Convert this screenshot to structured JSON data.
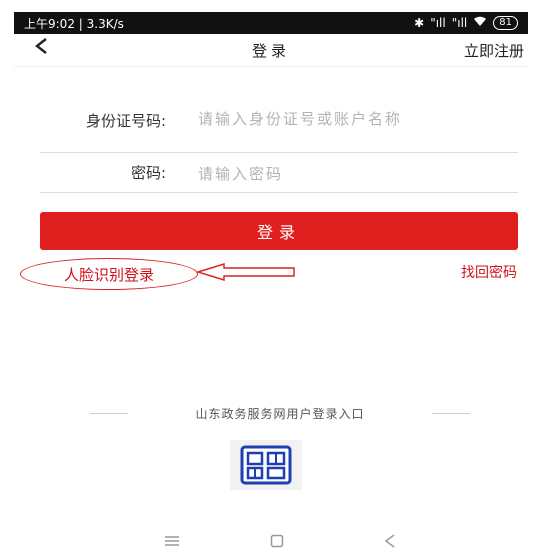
{
  "status_bar": {
    "time_speed": "上午9:02 | 3.3K/s",
    "signal1": "\"ıll",
    "signal2": "\"ıll",
    "battery": "81"
  },
  "nav": {
    "title": "登录",
    "register": "立即注册"
  },
  "form": {
    "id_label": "身份证号码:",
    "id_placeholder": "请输入身份证号或账户名称",
    "password_label": "密码:",
    "password_placeholder": "请输入密码",
    "login_button": "登录"
  },
  "links": {
    "face_login": "人脸识别登录",
    "find_password": "找回密码"
  },
  "footer": {
    "portal_text": "山东政务服务网用户登录入口"
  },
  "colors": {
    "accent": "#e0201e",
    "link_red": "#d0101a"
  }
}
